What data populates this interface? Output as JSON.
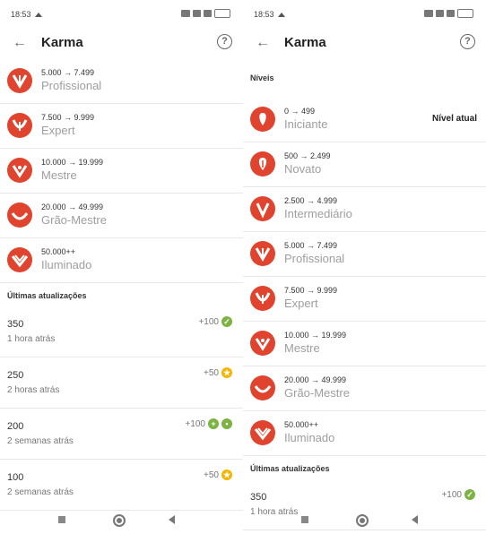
{
  "status": {
    "time": "18:53"
  },
  "appbar": {
    "title": "Karma",
    "back_icon": "arrow-back-icon",
    "help_icon": "help-circle-icon"
  },
  "brand_color": "#e0442e",
  "left": {
    "levels": [
      {
        "range": "5.000 → 7.499",
        "name": "Profissional"
      },
      {
        "range": "7.500 → 9.999",
        "name": "Expert"
      },
      {
        "range": "10.000 → 19.999",
        "name": "Mestre"
      },
      {
        "range": "20.000 → 49.999",
        "name": "Grão-Mestre"
      },
      {
        "range": "50.000++",
        "name": "Iluminado"
      }
    ],
    "updates_title": "Últimas atualizações",
    "updates": [
      {
        "value": "350",
        "when": "1 hora atrás",
        "points": "+100"
      },
      {
        "value": "250",
        "when": "2 horas atrás",
        "points": "+50"
      },
      {
        "value": "200",
        "when": "2 semanas atrás",
        "points": "+100"
      },
      {
        "value": "100",
        "when": "2 semanas atrás",
        "points": "+50"
      }
    ]
  },
  "right": {
    "levels_title": "Níveis",
    "current_label": "Nível atual",
    "levels": [
      {
        "range": "0 → 499",
        "name": "Iniciante"
      },
      {
        "range": "500 → 2.499",
        "name": "Novato"
      },
      {
        "range": "2.500 → 4.999",
        "name": "Intermediário"
      },
      {
        "range": "5.000 → 7.499",
        "name": "Profissional"
      },
      {
        "range": "7.500 → 9.999",
        "name": "Expert"
      },
      {
        "range": "10.000 → 19.999",
        "name": "Mestre"
      },
      {
        "range": "20.000 → 49.999",
        "name": "Grão-Mestre"
      },
      {
        "range": "50.000++",
        "name": "Iluminado"
      }
    ],
    "updates_title": "Últimas atualizações",
    "updates": [
      {
        "value": "350",
        "when": "1 hora atrás",
        "points": "+100"
      }
    ]
  }
}
